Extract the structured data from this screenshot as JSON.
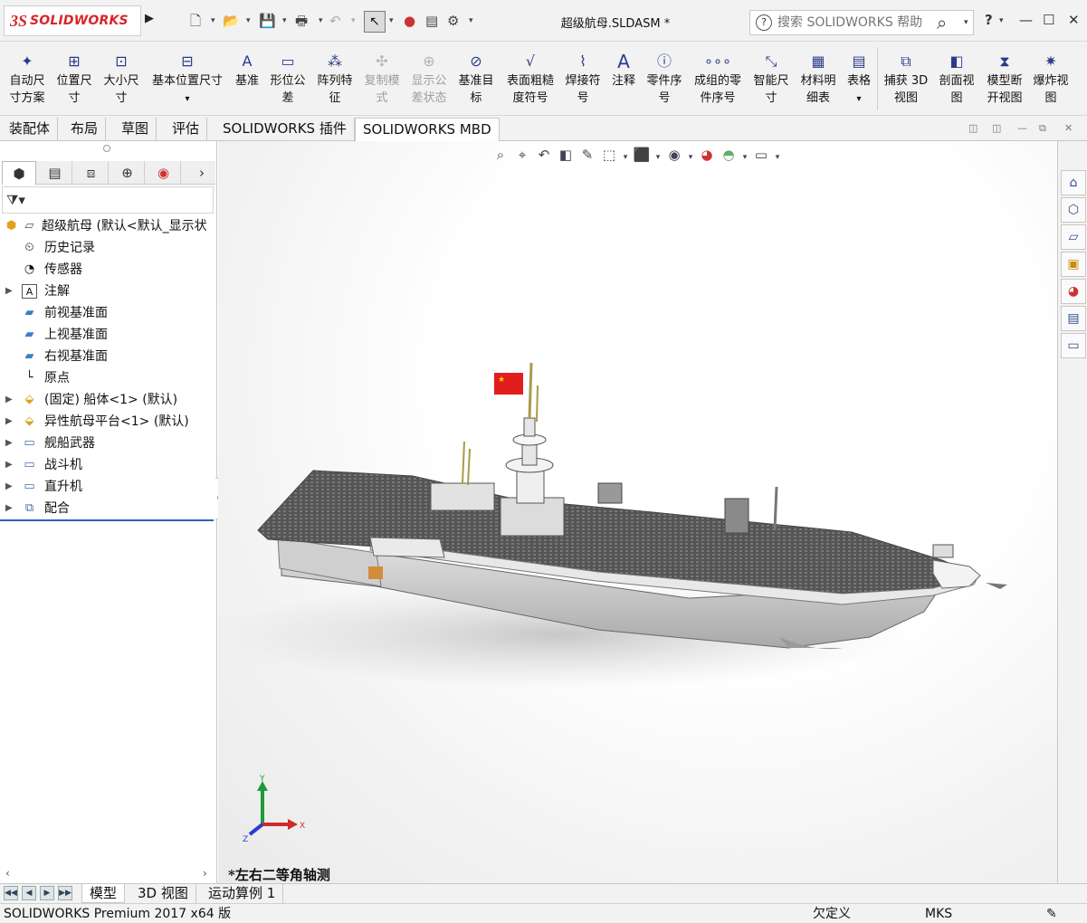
{
  "app": {
    "brand_prefix": "3S",
    "brand_name": "SOLIDWORKS",
    "document_title": "超级航母.SLDASM *",
    "search_placeholder": "搜索 SOLIDWORKS 帮助",
    "help": "?"
  },
  "command_manager": {
    "buttons": [
      {
        "label": "自动尺\n寸方案",
        "icon": "auto-dimension-icon",
        "enabled": true
      },
      {
        "label": "位置尺\n寸",
        "icon": "location-dimension-icon",
        "enabled": true
      },
      {
        "label": "大小尺\n寸",
        "icon": "size-dimension-icon",
        "enabled": true
      },
      {
        "label": "基本位置尺寸",
        "icon": "basic-location-dimension-icon",
        "enabled": true
      },
      {
        "label": "基准",
        "icon": "datum-icon",
        "enabled": true
      },
      {
        "label": "形位公\n差",
        "icon": "geometric-tolerance-icon",
        "enabled": true
      },
      {
        "label": "阵列特\n征",
        "icon": "pattern-feature-icon",
        "enabled": true
      },
      {
        "label": "复制模\n式",
        "icon": "copy-scheme-icon",
        "enabled": false
      },
      {
        "label": "显示公\n差状态",
        "icon": "show-tolerance-status-icon",
        "enabled": false
      },
      {
        "label": "基准目\n标",
        "icon": "datum-target-icon",
        "enabled": true
      },
      {
        "label": "表面粗糙\n度符号",
        "icon": "surface-finish-icon",
        "enabled": true
      },
      {
        "label": "焊接符\n号",
        "icon": "weld-symbol-icon",
        "enabled": true
      },
      {
        "label": "注释",
        "icon": "note-icon",
        "enabled": true
      },
      {
        "label": "零件序\n号",
        "icon": "balloon-icon",
        "enabled": true
      },
      {
        "label": "成组的零\n件序号",
        "icon": "stacked-balloon-icon",
        "enabled": true
      },
      {
        "label": "智能尺\n寸",
        "icon": "smart-dimension-icon",
        "enabled": true
      },
      {
        "label": "材料明\n细表",
        "icon": "bill-of-materials-icon",
        "enabled": true
      },
      {
        "label": "表格",
        "icon": "table-icon",
        "enabled": true
      },
      {
        "label": "捕获 3D\n视图",
        "icon": "capture-3d-view-icon",
        "enabled": true
      },
      {
        "label": "剖面视\n图",
        "icon": "section-view-icon",
        "enabled": true
      },
      {
        "label": "模型断\n开视图",
        "icon": "model-break-view-icon",
        "enabled": true
      },
      {
        "label": "爆炸视\n图",
        "icon": "exploded-view-icon",
        "enabled": true
      }
    ]
  },
  "tabs": [
    "装配体",
    "布局",
    "草图",
    "评估",
    "SOLIDWORKS 插件",
    "SOLIDWORKS MBD"
  ],
  "active_tab": "SOLIDWORKS MBD",
  "feature_tree": {
    "root": "超级航母 (默认<默认_显示状",
    "items": [
      {
        "label": "历史记录",
        "icon": "history-icon",
        "expandable": false
      },
      {
        "label": "传感器",
        "icon": "sensor-icon",
        "expandable": false
      },
      {
        "label": "注解",
        "icon": "annotation-icon",
        "expandable": true
      },
      {
        "label": "前视基准面",
        "icon": "plane-icon",
        "expandable": false
      },
      {
        "label": "上视基准面",
        "icon": "plane-icon",
        "expandable": false
      },
      {
        "label": "右视基准面",
        "icon": "plane-icon",
        "expandable": false
      },
      {
        "label": "原点",
        "icon": "origin-icon",
        "expandable": false
      },
      {
        "label": "(固定) 船体<1> (默认)",
        "icon": "part-icon",
        "expandable": true
      },
      {
        "label": "异性航母平台<1> (默认)",
        "icon": "part-icon",
        "expandable": true
      },
      {
        "label": "舰船武器",
        "icon": "folder-icon",
        "expandable": true
      },
      {
        "label": "战斗机",
        "icon": "folder-icon",
        "expandable": true
      },
      {
        "label": "直升机",
        "icon": "folder-icon",
        "expandable": true
      },
      {
        "label": "配合",
        "icon": "mates-icon",
        "expandable": true
      }
    ]
  },
  "viewport": {
    "view_label": "*左右二等角轴测",
    "triad": {
      "x": "X",
      "y": "Y",
      "z": "Z"
    },
    "colors": {
      "hull": "#d2d2d2",
      "deck": "#4a4a4a",
      "flag": "#e11d1d",
      "star": "#ffd400"
    }
  },
  "bottom_tabs": [
    "模型",
    "3D 视图",
    "运动算例 1"
  ],
  "active_bottom_tab": "模型",
  "status": {
    "product": "SOLIDWORKS Premium 2017 x64 版",
    "state": "欠定义",
    "units": "MKS"
  }
}
